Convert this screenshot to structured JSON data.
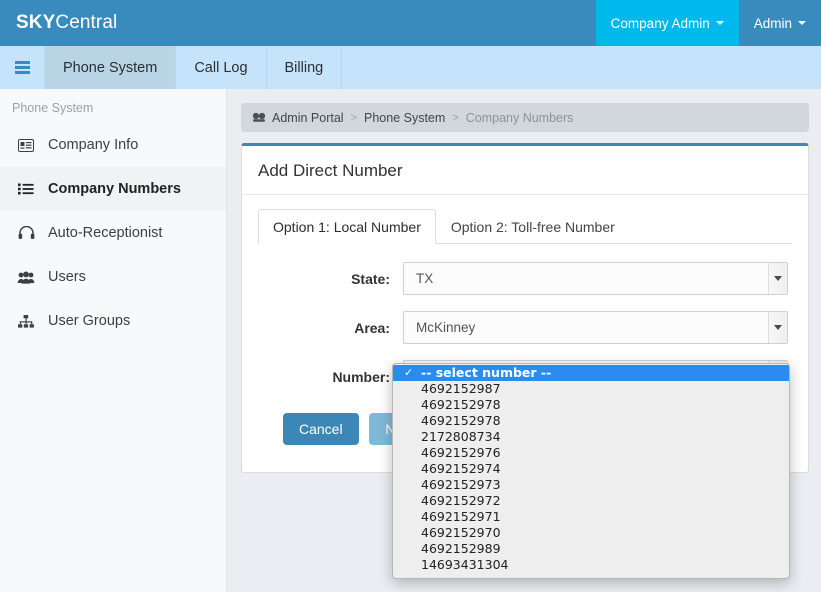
{
  "header": {
    "brand_bold": "SKY",
    "brand_rest": "Central",
    "menus": [
      {
        "label": "Company Admin",
        "icon": "chevron-down-icon",
        "active": true
      },
      {
        "label": "Admin",
        "icon": "chevron-down-icon",
        "active": false
      }
    ],
    "brand_color": "#3a8bbd",
    "accent_color": "#00b8ec"
  },
  "nav": {
    "menu_icon": "hamburger-icon",
    "tabs": [
      {
        "label": "Phone System",
        "active": true
      },
      {
        "label": "Call Log",
        "active": false
      },
      {
        "label": "Billing",
        "active": false
      }
    ],
    "bar_color": "#c5e4fb",
    "active_tab_color": "#b8d4e5"
  },
  "sidebar": {
    "heading": "Phone System",
    "items": [
      {
        "label": "Company Info",
        "icon": "id-card-icon",
        "active": false
      },
      {
        "label": "Company Numbers",
        "icon": "list-icon",
        "active": true
      },
      {
        "label": "Auto-Receptionist",
        "icon": "headset-icon",
        "active": false
      },
      {
        "label": "Users",
        "icon": "users-icon",
        "active": false
      },
      {
        "label": "User Groups",
        "icon": "sitemap-icon",
        "active": false
      }
    ]
  },
  "breadcrumb": {
    "icon": "portal-icon",
    "items": [
      {
        "label": "Admin Portal",
        "current": false
      },
      {
        "label": "Phone System",
        "current": false
      },
      {
        "label": "Company Numbers",
        "current": true
      }
    ],
    "separator": ">"
  },
  "panel": {
    "title": "Add Direct Number",
    "tabs": [
      {
        "label": "Option 1: Local Number",
        "active": true
      },
      {
        "label": "Option 2: Toll-free Number",
        "active": false
      }
    ],
    "fields": [
      {
        "label": "State:",
        "value": "TX",
        "icon": "chevron-down-icon"
      },
      {
        "label": "Area:",
        "value": "McKinney",
        "icon": "chevron-down-icon"
      },
      {
        "label": "Number:",
        "value": "-- select number --",
        "icon": "chevron-down-icon"
      }
    ],
    "buttons": [
      {
        "label": "Cancel",
        "style": "cancel"
      },
      {
        "label": "Next",
        "style": "next"
      }
    ]
  },
  "dropdown": {
    "open": true,
    "check_glyph": "✓",
    "options": [
      {
        "label": "-- select number --",
        "selected": true
      },
      {
        "label": "4692152987",
        "selected": false
      },
      {
        "label": "4692152978",
        "selected": false
      },
      {
        "label": "4692152978",
        "selected": false
      },
      {
        "label": "2172808734",
        "selected": false
      },
      {
        "label": "4692152976",
        "selected": false
      },
      {
        "label": "4692152974",
        "selected": false
      },
      {
        "label": "4692152973",
        "selected": false
      },
      {
        "label": "4692152972",
        "selected": false
      },
      {
        "label": "4692152971",
        "selected": false
      },
      {
        "label": "4692152970",
        "selected": false
      },
      {
        "label": "4692152989",
        "selected": false
      },
      {
        "label": "14693431304",
        "selected": false
      }
    ],
    "highlight_color": "#2b8cf0"
  }
}
